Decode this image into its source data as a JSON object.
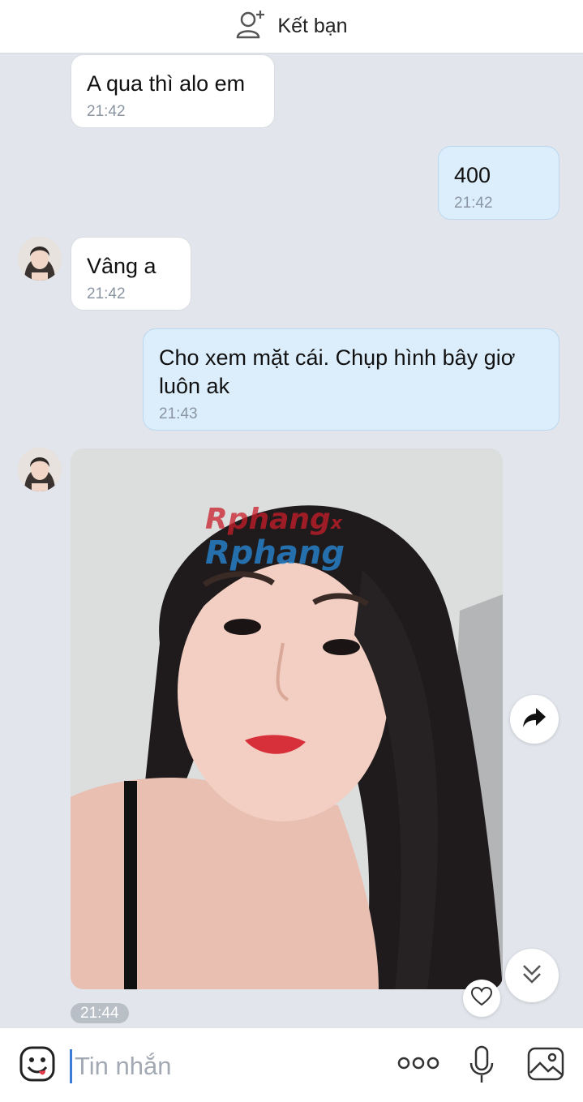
{
  "header": {
    "add_friend_label": "Kết bạn"
  },
  "messages": [
    {
      "text": "A qua thì alo em",
      "time": "21:42"
    },
    {
      "text": "400",
      "time": "21:42"
    },
    {
      "text": "Vâng a",
      "time": "21:42"
    },
    {
      "text": "Cho xem mặt cái. Chụp hình bây giơ luôn ak",
      "time": "21:43"
    }
  ],
  "photo": {
    "watermark_line1": "Rphang",
    "watermark_x": "x",
    "watermark_line2": "Rphang",
    "time": "21:44"
  },
  "composer": {
    "placeholder": "Tin nhắn"
  },
  "colors": {
    "chat_background": "#e2e6ec",
    "outgoing_bubble": "#dceefb",
    "incoming_bubble": "#ffffff",
    "accent": "#3d7bd9"
  },
  "icons": {
    "add_friend": "person-plus-icon",
    "share": "share-arrow-icon",
    "scroll_down": "double-chevron-down-icon",
    "like": "heart-icon",
    "emoji": "emoji-icon",
    "more": "more-dots-icon",
    "voice": "microphone-icon",
    "gallery": "image-icon"
  }
}
